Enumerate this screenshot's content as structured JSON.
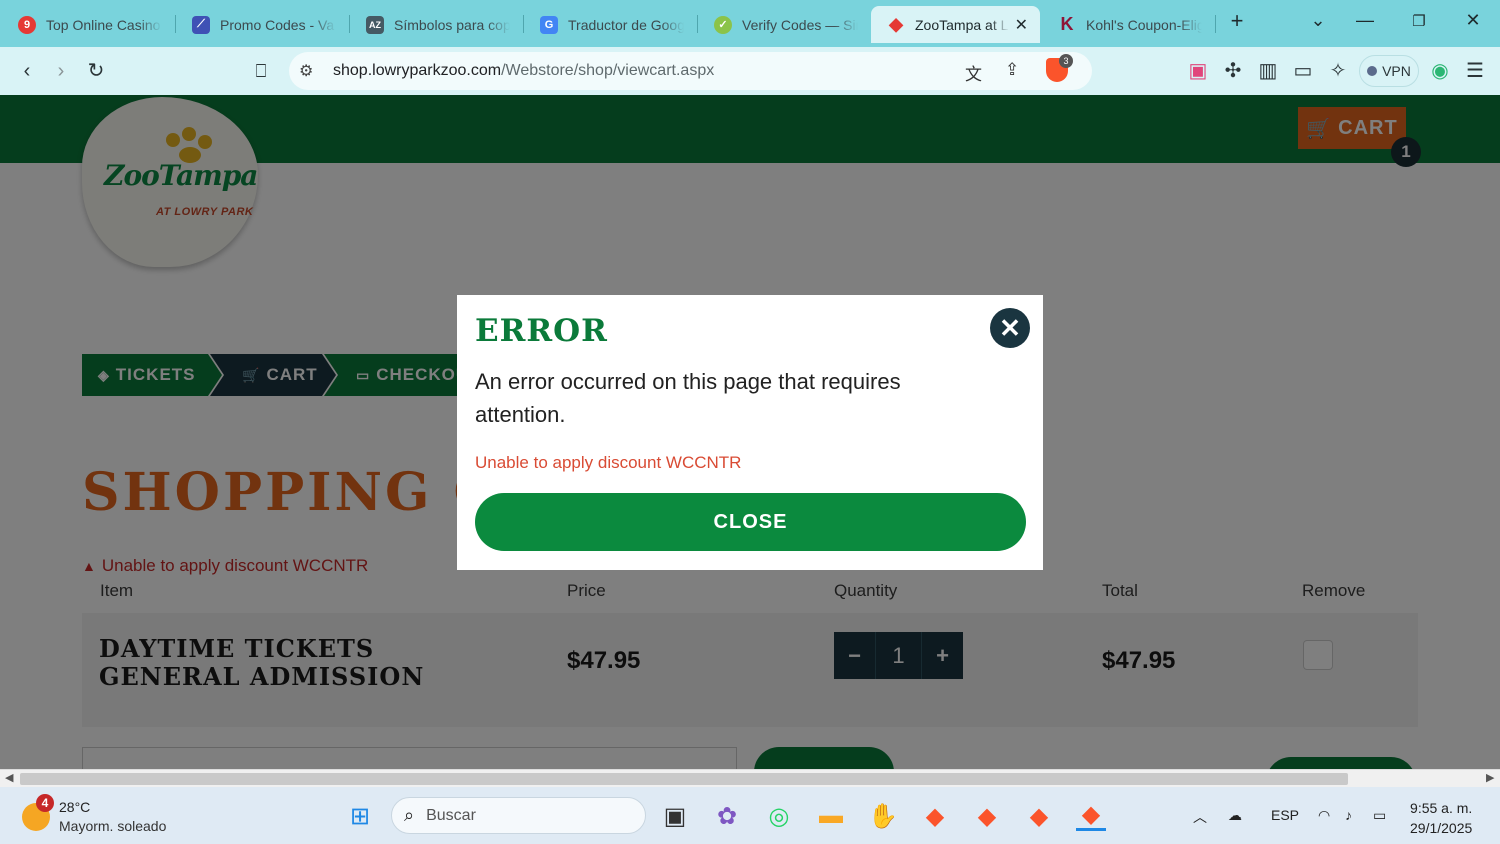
{
  "browser": {
    "tabs": [
      {
        "title": "Top Online Casino",
        "icon": "casino-icon",
        "color": "#e53935",
        "glyph": "9"
      },
      {
        "title": "Promo Codes - Va",
        "icon": "promo-icon",
        "color": "#3f51b5",
        "glyph": "⟋"
      },
      {
        "title": "Símbolos para cop",
        "icon": "az-icon",
        "color": "#455a64",
        "glyph": "AZ"
      },
      {
        "title": "Traductor de Goog",
        "icon": "translate-icon",
        "color": "#4285f4",
        "glyph": "G"
      },
      {
        "title": "Verify Codes — Sir",
        "icon": "verify-icon",
        "color": "#8bc34a",
        "glyph": "✓"
      },
      {
        "title": "ZooTampa at L",
        "icon": "zootampa-tab-icon",
        "color": "#e53935",
        "glyph": "◆"
      },
      {
        "title": "Kohl's Coupon-Elig",
        "icon": "kohls-icon",
        "color": "#8e1537",
        "glyph": "K"
      }
    ],
    "new_tab": "+",
    "url_host": "shop.lowryparkzoo.com",
    "url_path": "/Webstore/shop/viewcart.aspx",
    "shield_count": "3",
    "vpn_label": "VPN"
  },
  "site": {
    "logo_text": "ZooTampa",
    "logo_sub": "AT LOWRY PARK",
    "cart_label": "CART",
    "cart_count": "1",
    "steps": [
      "TICKETS",
      "CART",
      "CHECKOUT"
    ],
    "title": "SHOPPING CART",
    "warning": "Unable to apply discount WCCNTR",
    "table_headers": [
      "Item",
      "Price",
      "Quantity",
      "Total",
      "Remove"
    ],
    "row": {
      "item": "DAYTIME TICKETS GENERAL ADMISSION",
      "price": "$47.95",
      "qty": "1",
      "total": "$47.95"
    }
  },
  "modal": {
    "title": "ERROR",
    "message": "An error occurred on this page that requires attention.",
    "error": "Unable to apply discount WCCNTR",
    "button": "CLOSE"
  },
  "taskbar": {
    "weather_temp": "28°C",
    "weather_cond": "Mayorm. soleado",
    "weather_badge": "4",
    "search_placeholder": "Buscar",
    "lang": "ESP",
    "time": "9:55 a. m.",
    "date": "29/1/2025"
  }
}
